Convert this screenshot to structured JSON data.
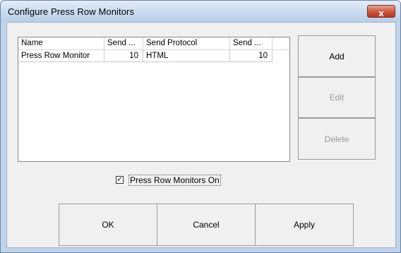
{
  "window": {
    "title": "Configure Press Row Monitors",
    "close_glyph": "x"
  },
  "list": {
    "columns": [
      "Name",
      "Send ...",
      "Send Protocol",
      "Send ..."
    ],
    "rows": [
      [
        "Press Row Monitor",
        "10",
        "HTML",
        "10"
      ]
    ]
  },
  "side_buttons": {
    "add": "Add",
    "edit": "Edit",
    "delete": "Delete"
  },
  "checkbox": {
    "label": "Press Row Monitors On",
    "checked_glyph": "✓"
  },
  "bottom_buttons": {
    "ok": "OK",
    "cancel": "Cancel",
    "apply": "Apply"
  },
  "colors": {
    "close_button": "#c94a30",
    "title_bar": "#c9dbef",
    "client_bg": "#f0f0f0"
  }
}
